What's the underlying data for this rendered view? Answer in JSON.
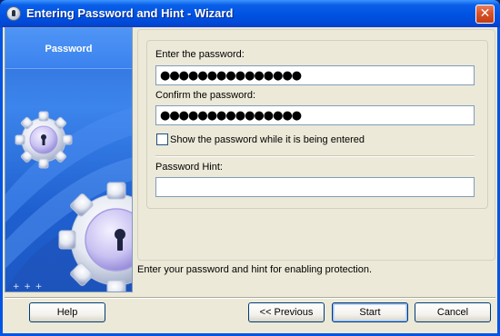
{
  "window": {
    "title": "Entering Password and Hint - Wizard",
    "close_glyph": "✕"
  },
  "sidebar": {
    "title": "Password",
    "dots": "+ + +"
  },
  "form": {
    "password_label": "Enter the password:",
    "password_value": "●●●●●●●●●●●●●●●",
    "confirm_label": "Confirm the password:",
    "confirm_value": "●●●●●●●●●●●●●●●",
    "show_password_label": "Show the password while it is being entered",
    "show_password_checked": false,
    "hint_label": "Password Hint:",
    "hint_value": ""
  },
  "status_text": "Enter your password and hint for enabling protection.",
  "buttons": {
    "help": "Help",
    "previous": "<< Previous",
    "start": "Start",
    "cancel": "Cancel"
  },
  "colors": {
    "titlebar": "#0054e3",
    "client_bg": "#ece9d8",
    "sidebar_bg": "#2f6fd8",
    "input_border": "#7f9db9"
  },
  "icons": [
    "app-lock-icon",
    "close-icon",
    "gear-lock-icon"
  ]
}
